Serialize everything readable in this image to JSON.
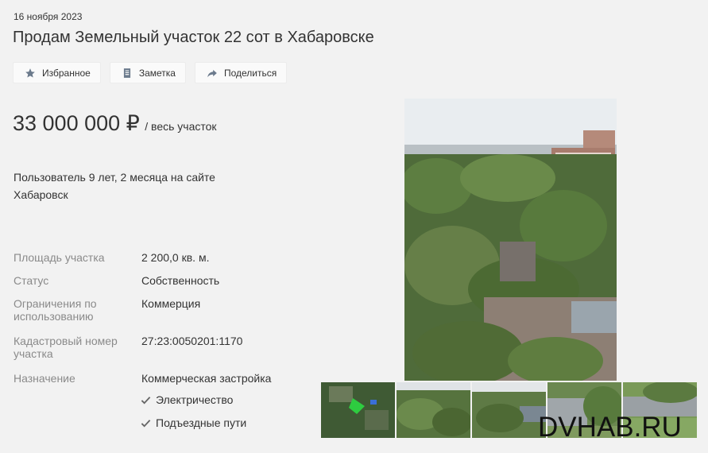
{
  "listing": {
    "date": "16 ноября 2023",
    "title": "Продам Земельный участок 22 сот в Хабаровске"
  },
  "actions": [
    {
      "label": "Избранное",
      "icon": "star-icon"
    },
    {
      "label": "Заметка",
      "icon": "note-icon"
    },
    {
      "label": "Поделиться",
      "icon": "share-icon"
    }
  ],
  "price": {
    "amount": "33 000 000 ₽",
    "unit": "/ весь участок"
  },
  "seller": {
    "tenure": "Пользователь 9 лет, 2 месяца на сайте",
    "city": "Хабаровск"
  },
  "properties": [
    {
      "key": "Площадь участка",
      "value": "2 200,0 кв. м."
    },
    {
      "key": "Статус",
      "value": "Собственность"
    },
    {
      "key": "Ограничения по использованию",
      "value": "Коммерция"
    },
    {
      "key": "Кадастровый номер участка",
      "value": "27:23:0050201:1170"
    },
    {
      "key": "Назначение",
      "value": "Коммерческая застройка"
    }
  ],
  "features": [
    "Электричество",
    "Подъездные пути"
  ],
  "watermark": "DVHAB.RU",
  "colors": {
    "background": "#f2f2f2",
    "label": "#8a8a8a",
    "icon": "#6b7a8c"
  }
}
